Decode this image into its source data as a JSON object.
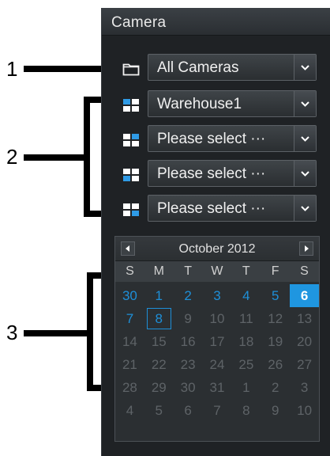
{
  "panel": {
    "title": "Camera",
    "rows": [
      {
        "type": "folder",
        "label": "All Cameras"
      },
      {
        "type": "grid",
        "label": "Warehouse1"
      },
      {
        "type": "grid",
        "label": "Please select ···"
      },
      {
        "type": "grid",
        "label": "Please select ···"
      },
      {
        "type": "grid",
        "label": "Please select ···"
      }
    ],
    "dropdown_icon": "chevron-down-icon"
  },
  "calendar": {
    "title": "October 2012",
    "prev_icon": "triangle-left-icon",
    "next_icon": "triangle-right-icon",
    "weekdays": [
      "S",
      "M",
      "T",
      "W",
      "T",
      "F",
      "S"
    ],
    "days": [
      [
        "30",
        "1",
        "2",
        "3",
        "4",
        "5",
        "6"
      ],
      [
        "7",
        "8",
        "9",
        "10",
        "11",
        "12",
        "13"
      ],
      [
        "14",
        "15",
        "16",
        "17",
        "18",
        "19",
        "20"
      ],
      [
        "21",
        "22",
        "23",
        "24",
        "25",
        "26",
        "27"
      ],
      [
        "28",
        "29",
        "30",
        "31",
        "1",
        "2",
        "3"
      ],
      [
        "4",
        "5",
        "6",
        "7",
        "8",
        "9",
        "10"
      ]
    ],
    "highlighted_selected": "6",
    "focused": "8",
    "colors": {
      "accent": "#1e8fd8",
      "selected_bg": "#1f96e0",
      "dim": "#5e6367"
    }
  },
  "callouts": [
    "1",
    "2",
    "3"
  ]
}
